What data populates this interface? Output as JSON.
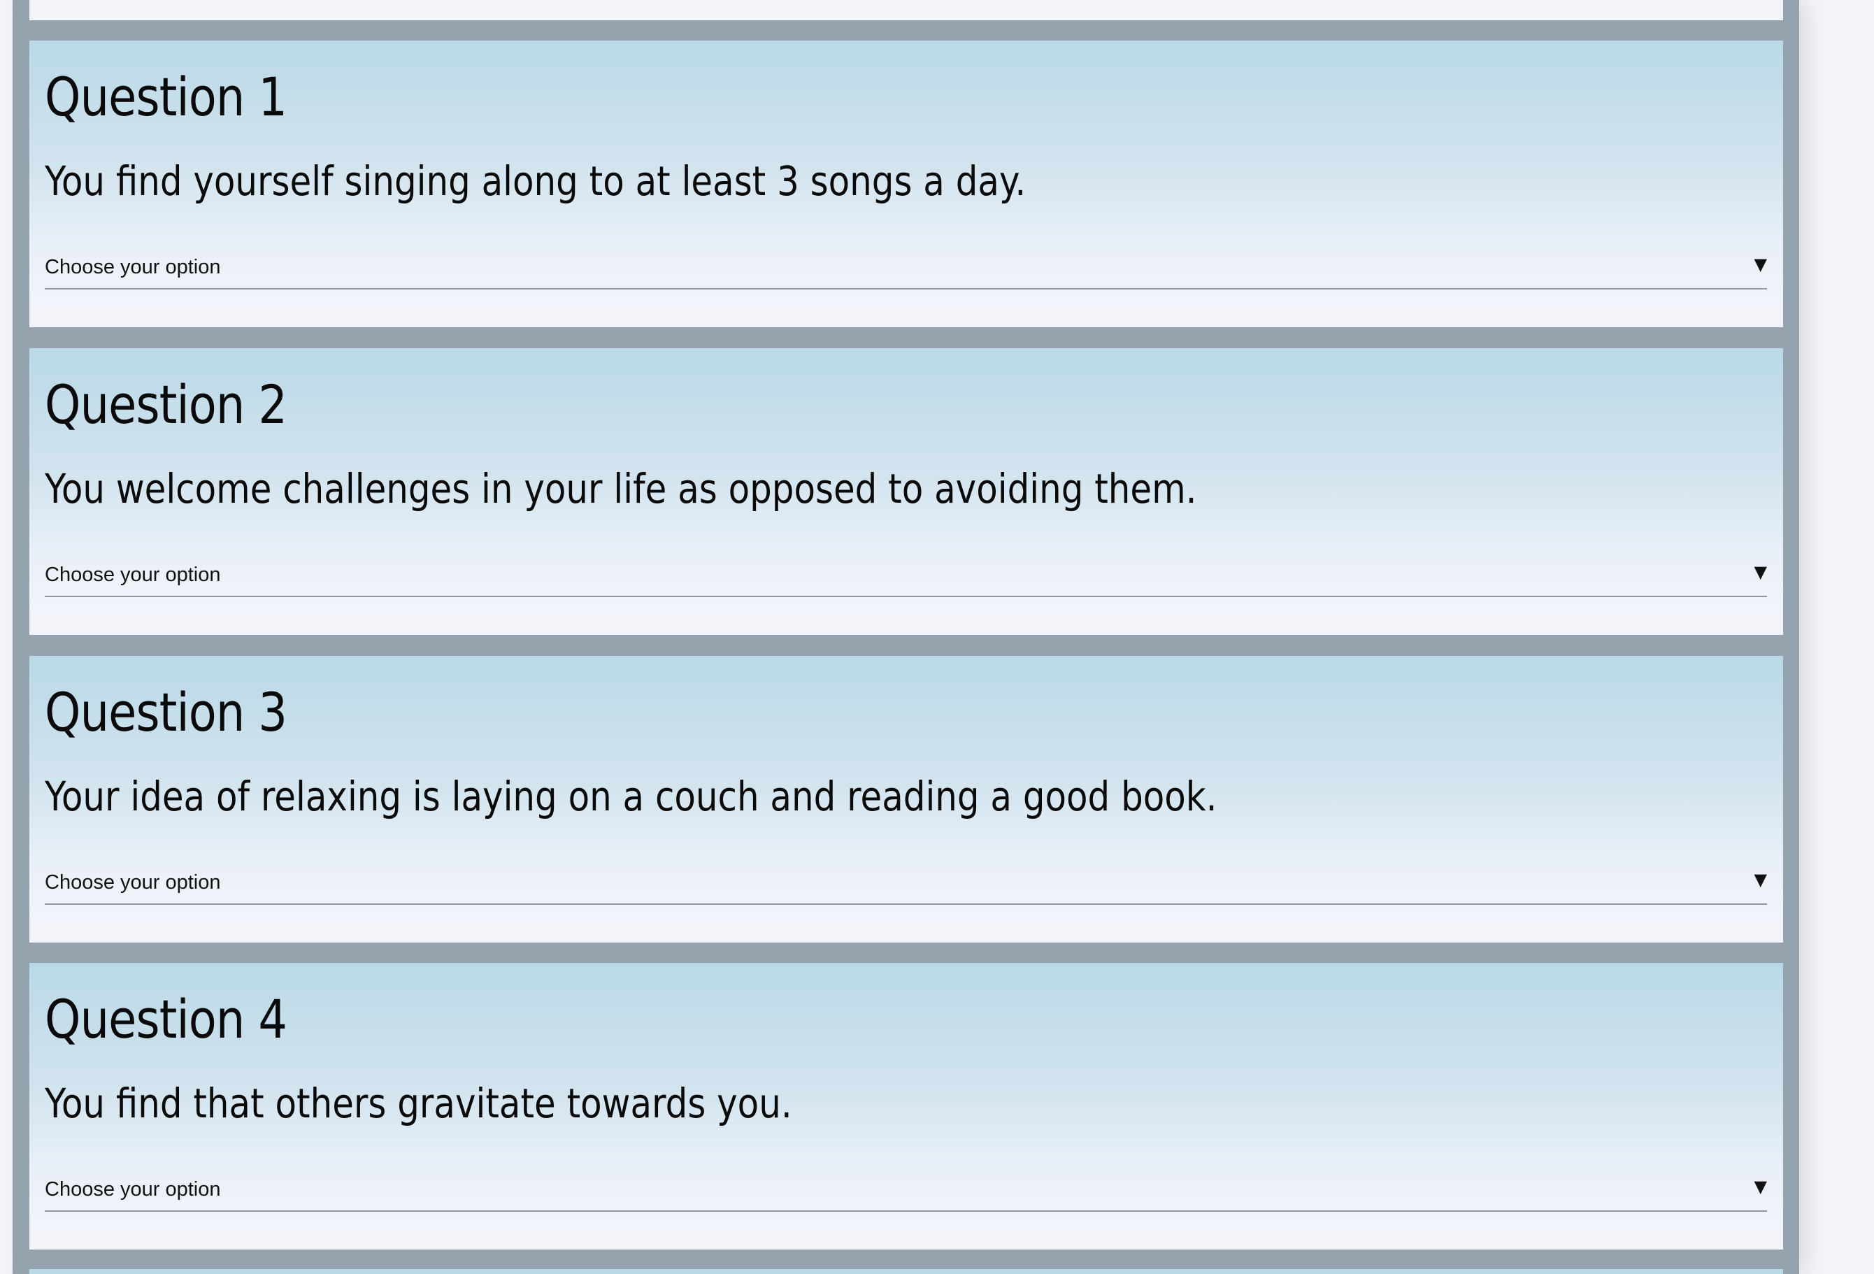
{
  "questions": [
    {
      "title": "Question 1",
      "text": "You find yourself singing along to at least 3 songs a day.",
      "select_label": "Choose your option",
      "arrow_glyph": "▼"
    },
    {
      "title": "Question 2",
      "text": "You welcome challenges in your life as opposed to avoiding them.",
      "select_label": "Choose your option",
      "arrow_glyph": "▼"
    },
    {
      "title": "Question 3",
      "text": "Your idea of relaxing is laying on a couch and reading a good book.",
      "select_label": "Choose your option",
      "arrow_glyph": "▼"
    },
    {
      "title": "Question 4",
      "text": "You find that others gravitate towards you.",
      "select_label": "Choose your option",
      "arrow_glyph": "▼"
    }
  ],
  "colors": {
    "page_background": "#f4f5fb",
    "column_background": "#94a3ae",
    "card_gradient_top": "#b9d9e6",
    "card_gradient_bottom": "#f4f5fb",
    "text": "#0a0a0a",
    "select_underline": "#8d969b"
  },
  "icons": {
    "dropdown_arrow": "dropdown-arrow-icon"
  }
}
